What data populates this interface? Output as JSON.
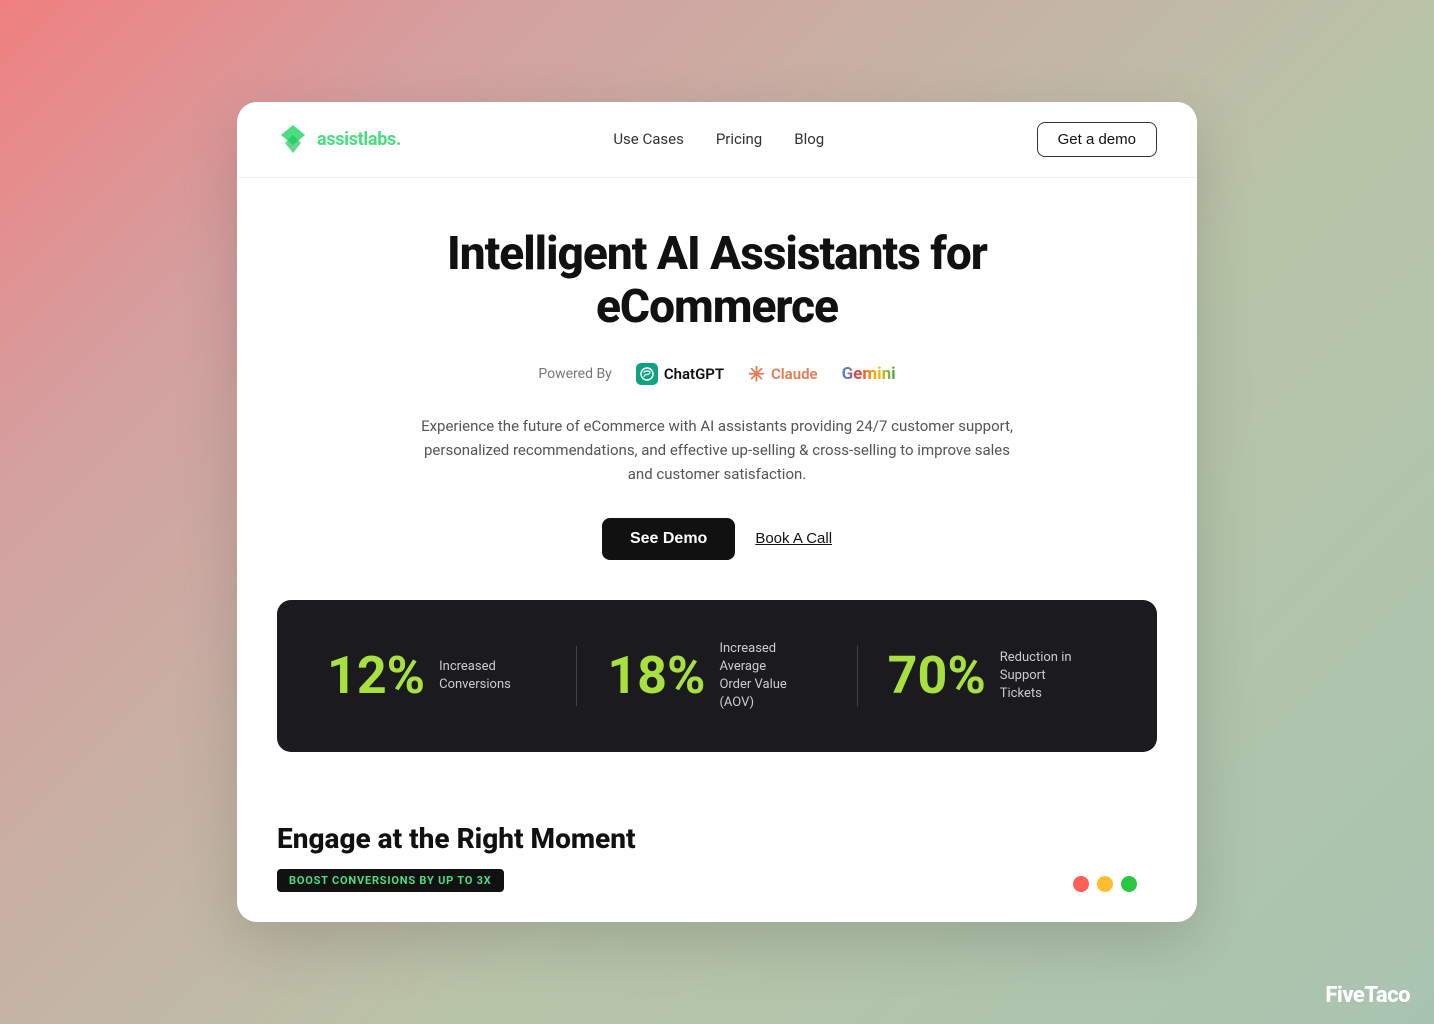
{
  "nav": {
    "logo_text": "assistlabs",
    "logo_dot": ".",
    "links": [
      "Use Cases",
      "Pricing",
      "Blog"
    ],
    "demo_btn": "Get a demo"
  },
  "hero": {
    "title_line1": "Intelligent AI Assistants for",
    "title_line2": "eCommerce",
    "powered_label": "Powered By",
    "ai_providers": [
      {
        "name": "ChatGPT",
        "icon": "chatgpt"
      },
      {
        "name": "Claude",
        "icon": "claude"
      },
      {
        "name": "Gemini",
        "icon": "gemini"
      }
    ],
    "description": "Experience the future of eCommerce with AI assistants providing 24/7 customer support, personalized recommendations, and effective up-selling & cross-selling to improve sales and customer satisfaction.",
    "see_demo_btn": "See Demo",
    "book_call_link": "Book A Call"
  },
  "stats": [
    {
      "number": "12%",
      "label": "Increased Conversions"
    },
    {
      "number": "18%",
      "label": "Increased Average Order Value (AOV)"
    },
    {
      "number": "70%",
      "label": "Reduction in Support Tickets"
    }
  ],
  "bottom": {
    "section_title": "Engage at the Right Moment",
    "badge_text": "BOOST CONVERSIONS BY UP TO 3X"
  },
  "watermark": {
    "text": "FiveTaco"
  }
}
